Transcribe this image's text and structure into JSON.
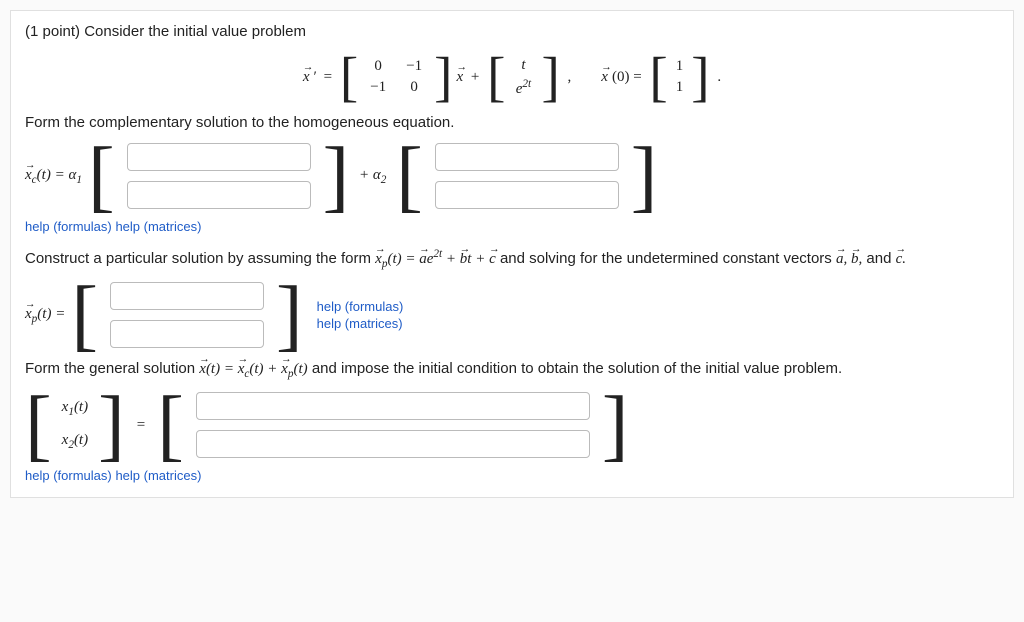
{
  "heading": "(1 point) Consider the initial value problem",
  "eq": {
    "lhs": "x′ =",
    "A": [
      [
        "0",
        "−1"
      ],
      [
        "−1",
        "0"
      ]
    ],
    "mid1": " x +",
    "g": [
      "t",
      "e^{2t}"
    ],
    "g_display": [
      "t",
      "e"
    ],
    "comma": ",",
    "ic_label": "x(0) =",
    "ic": [
      "1",
      "1"
    ],
    "period": "."
  },
  "prompts": {
    "complementary": "Form the complementary solution to the homogeneous equation.",
    "xc_pre": "x_c(t) = α₁",
    "plus_alpha2": " + α₂ ",
    "help_formulas": "help (formulas)",
    "help_matrices": "help (matrices)",
    "particular_intro_pre": "Construct a particular solution by assuming the form ",
    "particular_form": "x_p(t) = a e^{2t} + b t + c",
    "particular_intro_post": " and solving for the undetermined constant vectors ",
    "vectors_list": "a, b, and c.",
    "xp_pre": "x_p(t) =",
    "general_intro_pre": "Form the general solution ",
    "general_form": "x(t) = x_c(t) + x_p(t)",
    "general_intro_post": " and impose the initial condition to obtain the solution of the initial value problem.",
    "x1": "x₁(t)",
    "x2": "x₂(t)",
    "equals": "="
  }
}
